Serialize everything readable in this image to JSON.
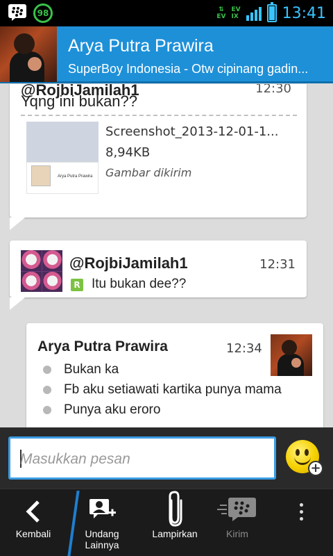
{
  "status_bar": {
    "battery_badge": "98",
    "network_top": "EV",
    "network_ev": "EV",
    "network_ix": "IX",
    "time": "13:41"
  },
  "header": {
    "contact_name": "Arya Putra Prawira",
    "status_message": "SuperBoy Indonesia - Otw cipinang gadin..."
  },
  "messages": [
    {
      "sender": "@RojbiJamilah1",
      "time": "12:30",
      "text": "Yqng ini bukan??",
      "attachment": {
        "thumb_caption": "Arya Putra Prawira",
        "file_name": "Screenshot_2013-12-01-1...",
        "file_size": "8,94KB",
        "status": "Gambar dikirim"
      }
    },
    {
      "sender": "@RojbiJamilah1",
      "time": "12:31",
      "status_icon": "R",
      "text": "Itu bukan dee??"
    },
    {
      "sender": "Arya Putra Prawira",
      "time": "12:34",
      "lines": [
        "Bukan ka",
        "Fb aku setiawati kartika punya mama",
        "Punya aku eroro"
      ]
    }
  ],
  "composer": {
    "placeholder": "Masukkan pesan"
  },
  "actions": {
    "back": "Kembali",
    "invite_line1": "Undang",
    "invite_line2": "Lainnya",
    "attach": "Lampirkan",
    "send": "Kirim"
  },
  "colors": {
    "header_bg": "#1e90d8",
    "accent_blue": "#3a9ee6",
    "status_green": "#39c04a"
  }
}
